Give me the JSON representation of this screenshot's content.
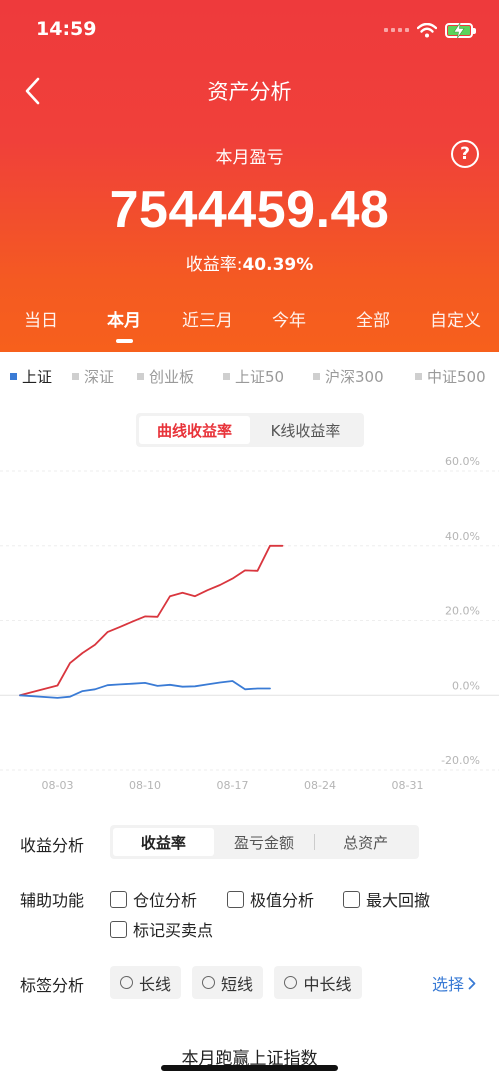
{
  "status": {
    "time": "14:59"
  },
  "header": {
    "title": "资产分析"
  },
  "summary": {
    "label": "本月盈亏",
    "help": "?",
    "amount": "7544459.48",
    "yield_label": "收益率:",
    "yield_value": "40.39%"
  },
  "period_tabs": [
    "当日",
    "本月",
    "近三月",
    "今年",
    "全部",
    "自定义"
  ],
  "period_active": "本月",
  "index_tabs": [
    "上证",
    "深证",
    "创业板",
    "上证50",
    "沪深300",
    "中证500"
  ],
  "index_active": "上证",
  "chart_mode": {
    "options": [
      "曲线收益率",
      "K线收益率"
    ],
    "active": "曲线收益率"
  },
  "chart_data": {
    "type": "line",
    "x_ticks": [
      "08-03",
      "08-10",
      "08-17",
      "08-24",
      "08-31"
    ],
    "y_ticks": [
      "60.0%",
      "40.0%",
      "20.0%",
      "0.0%",
      "-20.0%"
    ],
    "ylim": [
      -20,
      60
    ],
    "grid": true,
    "x_unit": "day of August",
    "x_range": [
      0,
      34
    ],
    "series": [
      {
        "color": "#d9363e",
        "x": [
          0,
          3,
          4,
          5,
          6,
          7,
          8,
          9,
          10,
          11,
          12,
          13,
          14,
          15,
          16,
          17,
          18,
          19,
          20,
          21
        ],
        "y": [
          0.0,
          2.6,
          8.6,
          11.3,
          13.5,
          16.9,
          18.3,
          19.7,
          21.1,
          21.0,
          26.5,
          27.4,
          26.5,
          28.1,
          29.5,
          31.2,
          33.4,
          33.3,
          40.0,
          40.0
        ]
      },
      {
        "color": "#3a7bd5",
        "x": [
          0,
          3,
          4,
          5,
          6,
          7,
          8,
          9,
          10,
          11,
          12,
          13,
          14,
          15,
          16,
          17,
          18,
          19,
          20
        ],
        "y": [
          0.0,
          -0.7,
          -0.4,
          1.1,
          1.6,
          2.7,
          2.9,
          3.1,
          3.3,
          2.5,
          2.8,
          2.3,
          2.4,
          2.9,
          3.4,
          3.8,
          1.6,
          1.8,
          1.8
        ]
      }
    ]
  },
  "analysis": {
    "label": "收益分析",
    "options": [
      "收益率",
      "盈亏金额",
      "总资产"
    ],
    "active": "收益率"
  },
  "aux": {
    "label": "辅助功能",
    "options": [
      "仓位分析",
      "极值分析",
      "最大回撤",
      "标记买卖点"
    ]
  },
  "tags": {
    "label": "标签分析",
    "options": [
      "长线",
      "短线",
      "中长线"
    ],
    "select": "选择"
  },
  "footer": {
    "text": "本月跑赢上证指数"
  },
  "colors": {
    "hero_top": "#ee3a3c",
    "hero_bottom": "#f7601c",
    "accent_red": "#e8333a",
    "accent_blue": "#3a7bd5"
  }
}
